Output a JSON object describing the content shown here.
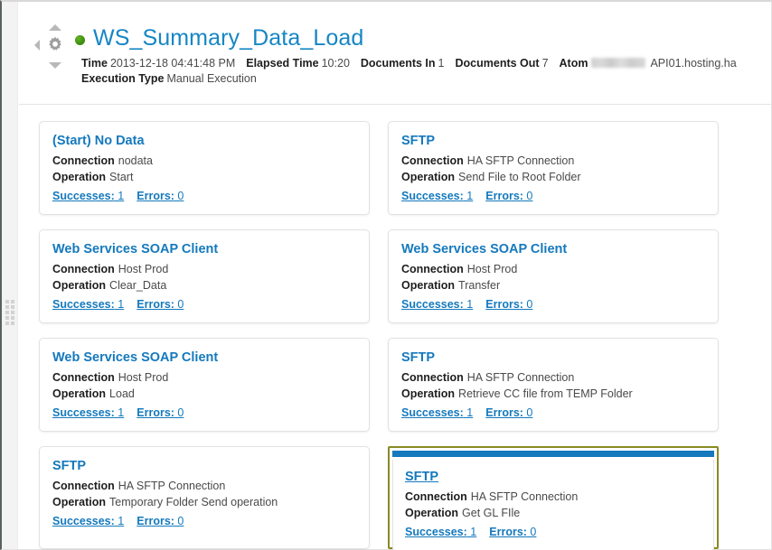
{
  "header": {
    "status": "success",
    "status_color": "#3f9010",
    "title": "WS_Summary_Data_Load",
    "accent_color": "#1586c4",
    "meta": {
      "time_label": "Time",
      "time_value": "2013-12-18 04:41:48 PM",
      "elapsed_label": "Elapsed Time",
      "elapsed_value": "10:20",
      "docs_in_label": "Documents In",
      "docs_in_value": "1",
      "docs_out_label": "Documents Out",
      "docs_out_value": "7",
      "atom_label": "Atom",
      "atom_value": "API01.hosting.ha",
      "execution_type_label": "Execution Type",
      "execution_type_value": "Manual Execution"
    },
    "nav": {
      "up_icon": "triangle-up-icon",
      "down_icon": "triangle-down-icon",
      "left_icon": "triangle-left-icon",
      "settings_icon": "gear-icon"
    }
  },
  "labels": {
    "connection": "Connection",
    "operation": "Operation",
    "successes": "Successes:",
    "errors": "Errors:",
    "link_color": "#1479bd",
    "selected_border_color": "#8a8a23"
  },
  "cards": [
    {
      "title": "(Start) No Data",
      "connection": "nodata",
      "operation": "Start",
      "successes": "1",
      "errors": "0",
      "selected": false
    },
    {
      "title": "SFTP",
      "connection": "HA SFTP Connection",
      "operation": "Send File to Root Folder",
      "successes": "1",
      "errors": "0",
      "selected": false
    },
    {
      "title": "Web Services SOAP Client",
      "connection": "Host Prod",
      "operation": "Clear_Data",
      "successes": "1",
      "errors": "0",
      "selected": false
    },
    {
      "title": "Web Services SOAP Client",
      "connection": "Host Prod",
      "operation": "Transfer",
      "successes": "1",
      "errors": "0",
      "selected": false
    },
    {
      "title": "Web Services SOAP Client",
      "connection": "Host Prod",
      "operation": "Load",
      "successes": "1",
      "errors": "0",
      "selected": false
    },
    {
      "title": "SFTP",
      "connection": "HA SFTP Connection",
      "operation": "Retrieve CC file from TEMP Folder",
      "successes": "1",
      "errors": "0",
      "selected": false
    },
    {
      "title": "SFTP",
      "connection": "HA SFTP Connection",
      "operation": "Temporary Folder Send operation",
      "successes": "1",
      "errors": "0",
      "selected": false
    },
    {
      "title": "SFTP",
      "connection": "HA SFTP Connection",
      "operation": "Get GL FIle",
      "successes": "1",
      "errors": "0",
      "selected": true
    }
  ]
}
